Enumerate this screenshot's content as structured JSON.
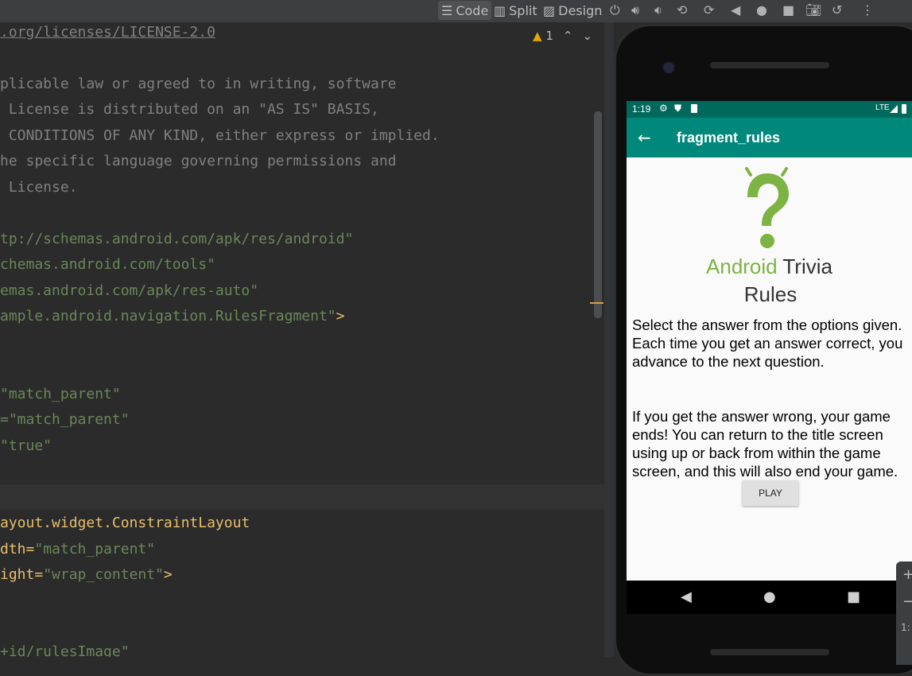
{
  "toolbar": {
    "code_label": "Code",
    "split_label": "Split",
    "design_label": "Design",
    "icons": [
      "power-icon",
      "volume-up-icon",
      "volume-down-icon",
      "rotate-left-icon",
      "rotate-right-icon",
      "back-icon",
      "home-icon",
      "overview-icon",
      "camera-icon",
      "replay-icon",
      "more-icon"
    ]
  },
  "inspection": {
    "warning_count": "1"
  },
  "code": {
    "lines": [
      {
        "text": ".org/licenses/LICENSE-2.0",
        "style": "link"
      },
      {
        "text": "plicable law or agreed to in writing, software",
        "style": "cmt"
      },
      {
        "text": " License is distributed on an \"AS IS\" BASIS,",
        "style": "cmt"
      },
      {
        "text": " CONDITIONS OF ANY KIND, either express or implied.",
        "style": "cmt"
      },
      {
        "text": "he specific language governing permissions and",
        "style": "cmt"
      },
      {
        "text": " License.",
        "style": "cmt"
      },
      {
        "text": "tp://schemas.android.com/apk/res/android\"",
        "style": "green"
      },
      {
        "text": "chemas.android.com/tools\"",
        "style": "green"
      },
      {
        "text": "emas.android.com/apk/res-auto\"",
        "style": "green"
      },
      {
        "text": "ample.android.navigation.RulesFragment\"",
        "style": "green",
        "suffix": ">"
      },
      {
        "text": "\"match_parent\"",
        "style": "green"
      },
      {
        "text": "=\"match_parent\"",
        "style": "green"
      },
      {
        "text": "\"true\"",
        "style": "green"
      },
      {
        "text": "ayout.widget.ConstraintLayout",
        "style": "yellow"
      },
      {
        "text": "dth=\"match_parent\"",
        "style": "mixed",
        "prefix": "dth=",
        "rest": "\"match_parent\""
      },
      {
        "text": "ight=\"wrap_content\">",
        "style": "mixed",
        "prefix": "ight=",
        "rest": "\"wrap_content\"",
        "suffix": ">"
      },
      {
        "text": "+id/rulesImage\"",
        "style": "green"
      }
    ]
  },
  "phone": {
    "status_time": "1:19",
    "status_network": "LTE",
    "app_title": "fragment_rules",
    "brand_part1": "Android",
    "brand_part2": " Trivia",
    "rules_title": "Rules",
    "rules_paragraph1": "Select the answer from the options given. Each time you get an answer correct, you advance to the next question.",
    "rules_paragraph2": "If you get the answer wrong, your game ends! You can return to the title screen using up or back from within the game screen, and this will also end your game.",
    "play_label": "PLAY",
    "colors": {
      "status_bar": "#00695c",
      "app_bar": "#00897b",
      "brand_green": "#7cb342"
    }
  },
  "side_panel": {
    "plus_label": "+",
    "minus_label": "−",
    "ratio_label": "1:"
  }
}
